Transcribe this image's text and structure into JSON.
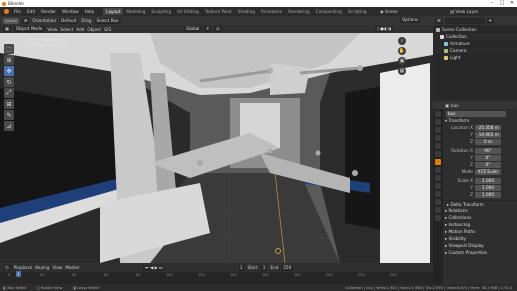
{
  "window": {
    "title": "Blender",
    "minimize": "–",
    "maximize": "□",
    "close": "✕"
  },
  "menu": {
    "items": [
      "File",
      "Edit",
      "Render",
      "Window",
      "Help"
    ],
    "workspaces": [
      "Layout",
      "Modeling",
      "Sculpting",
      "UV Editing",
      "Texture Paint",
      "Shading",
      "Animation",
      "Rendering",
      "Compositing",
      "Scripting"
    ],
    "active_workspace": "Layout",
    "scene": "Scene",
    "view_layer": "View Layer"
  },
  "tool_header": {
    "orientation_label": "Orientation",
    "orientation": "Default",
    "drag_label": "Drag",
    "drag": "Select Box",
    "options": "Options"
  },
  "viewport_header": {
    "mode": "Object Mode",
    "view": "View",
    "select": "Select",
    "add": "Add",
    "object": "Object",
    "gis": "GIS",
    "transform": "Global"
  },
  "viewport_info": {
    "line1": "User Perspective",
    "line2": "(1) Collection | bus"
  },
  "timeline": {
    "menus": [
      "Playback",
      "Keying",
      "View",
      "Marker"
    ],
    "current_frame": "1",
    "start_label": "Start",
    "start": "1",
    "end_label": "End",
    "end": "250",
    "ticks": [
      "0",
      "20",
      "40",
      "60",
      "80",
      "100",
      "120",
      "140",
      "160",
      "180",
      "200",
      "220",
      "240"
    ]
  },
  "status": {
    "left": "Box Select",
    "middle": "Rotate View",
    "right_select": "Lasso Select",
    "stats": "Collection | bus | Verts:1,940 | Faces:1,948 | Tris:2,956 | Objects:0/4 | Mem: 38.3 MiB | 2.92.0"
  },
  "outliner": {
    "search_placeholder": "",
    "rows": [
      {
        "label": "Scene Collection",
        "icon": "collection-icon",
        "color": "#bbbbbb"
      },
      {
        "label": "Collection",
        "icon": "collection-icon",
        "color": "#dddddd"
      },
      {
        "label": "Armature",
        "icon": "armature-icon",
        "color": "#7ec8e3"
      },
      {
        "label": "Camera",
        "icon": "camera-icon",
        "color": "#9fc87e"
      },
      {
        "label": "Light",
        "icon": "light-icon",
        "color": "#e3c96a"
      }
    ]
  },
  "properties": {
    "object_name": "bus",
    "object_field": "bus",
    "transform_label": "Transform",
    "location_label": "Location X",
    "location": [
      "-25.358 m",
      "-14.965 m",
      "0 m"
    ],
    "rotation_label": "Rotation X",
    "rotation": [
      "90°",
      "0°",
      "0°"
    ],
    "mode_label": "Mode",
    "mode": "XYZ Euler",
    "scale_label": "Scale X",
    "scale": [
      "1.000",
      "1.000",
      "1.000"
    ],
    "y_label": "Y",
    "z_label": "Z",
    "sections": [
      "Delta Transform",
      "Relations",
      "Collections",
      "Instancing",
      "Motion Paths",
      "Visibility",
      "Viewport Display",
      "Custom Properties"
    ]
  },
  "colors": {
    "accent": "#4772b3",
    "brand": "#e87d0d"
  }
}
